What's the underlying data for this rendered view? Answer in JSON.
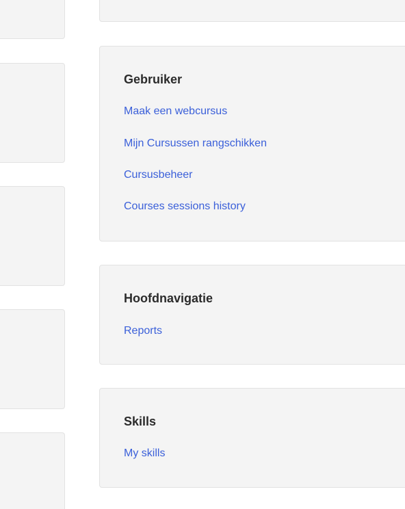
{
  "blocks": [
    {
      "title": "Gebruiker",
      "links": [
        "Maak een webcursus",
        "Mijn Cursussen rangschikken",
        "Cursusbeheer",
        "Courses sessions history"
      ]
    },
    {
      "title": "Hoofdnavigatie",
      "links": [
        "Reports"
      ]
    },
    {
      "title": "Skills",
      "links": [
        "My skills"
      ]
    }
  ],
  "colors": {
    "panel_background": "#f4f4f4",
    "panel_border": "#e2e2e2",
    "link": "#3a5fd9",
    "heading": "#2b2b2b"
  }
}
